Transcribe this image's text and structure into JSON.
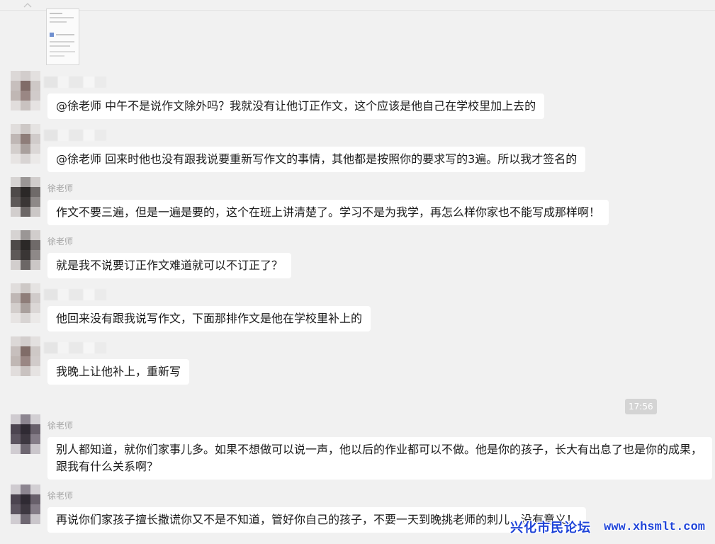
{
  "chat": {
    "messages": [
      {
        "text": "@徐老师 中午不是说作文除外吗？我就没有让他订正作文，这个应该是他自己在学校里加上去的"
      },
      {
        "text": "@徐老师 回来时他也没有跟我说要重新写作文的事情，其他都是按照你的要求写的3遍。所以我才签名的"
      },
      {
        "sender": "徐老师",
        "text": "作文不要三遍，但是一遍是要的，这个在班上讲清楚了。学习不是为我学，再怎么样你家也不能写成那样啊！"
      },
      {
        "sender": "徐老师",
        "text": "就是我不说要订正作文难道就可以不订正了？"
      },
      {
        "text": "他回来没有跟我说写作文，下面那排作文是他在学校里补上的"
      },
      {
        "text": "我晚上让他补上，重新写"
      },
      {
        "sender": "徐老师",
        "text": "别人都知道，就你们家事儿多。如果不想做可以说一声，他以后的作业都可以不做。他是你的孩子，长大有出息了也是你的成果，跟我有什么关系啊？"
      },
      {
        "sender": "徐老师",
        "text": "再说你们家孩子擅长撒谎你又不是不知道，管好你自己的孩子，不要一天到晚挑老师的刺儿，没有意义！"
      }
    ],
    "time_divider": "17:56"
  },
  "watermark": {
    "site_name": "兴化市民论坛",
    "url": "www.xhsmlt.com"
  },
  "colors": {
    "background": "#f1f1f1",
    "bubble": "#ffffff",
    "message_text": "#1b1b1b",
    "sender_name": "#a6a6a6",
    "time_pill": "#d4d4d4",
    "time_text": "#ffffff",
    "watermark": "#1f44d8"
  }
}
